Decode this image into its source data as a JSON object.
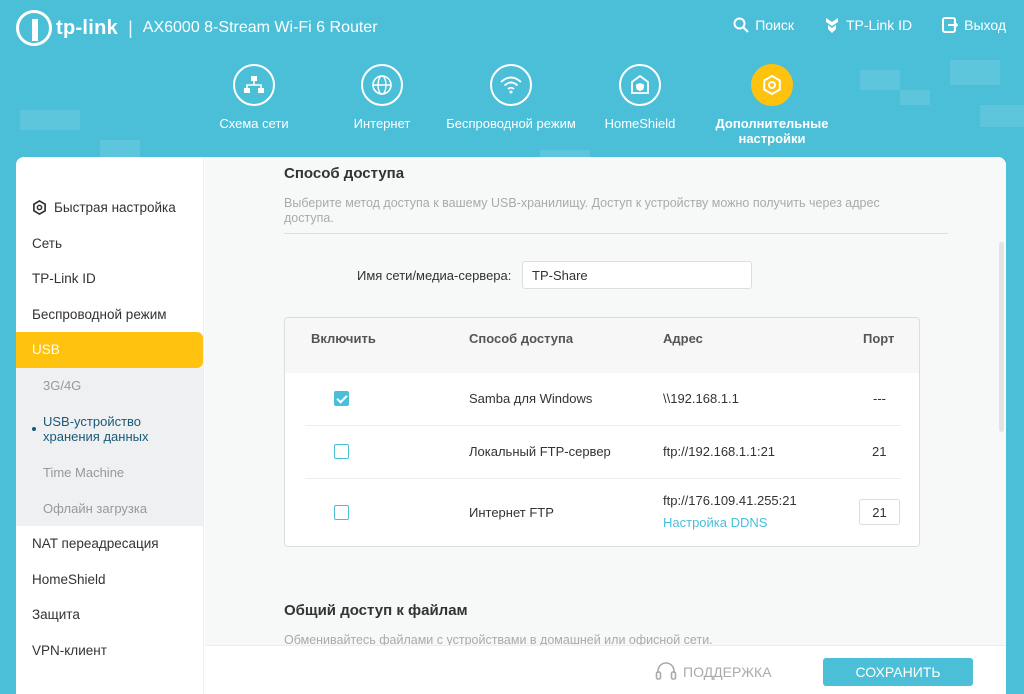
{
  "header": {
    "brand": "tp-link",
    "separator": "|",
    "model": "AX6000 8-Stream Wi-Fi 6 Router",
    "actions": [
      {
        "label": "Поиск",
        "icon": "search-icon"
      },
      {
        "label": "TP-Link ID",
        "icon": "tplink-id-icon"
      },
      {
        "label": "Выход",
        "icon": "logout-icon"
      }
    ]
  },
  "nav": [
    {
      "label": "Схема сети",
      "icon": "network-map-icon"
    },
    {
      "label": "Интернет",
      "icon": "globe-icon"
    },
    {
      "label": "Беспроводной режим",
      "icon": "wifi-icon"
    },
    {
      "label": "HomeShield",
      "icon": "shield-home-icon"
    },
    {
      "label": "Дополнительные настройки",
      "icon": "gear-icon",
      "active": true
    }
  ],
  "sidebar": {
    "items": [
      {
        "label": "Быстрая настройка",
        "icon": "gear-icon"
      },
      {
        "label": "Сеть"
      },
      {
        "label": "TP-Link ID"
      },
      {
        "label": "Беспроводной режим"
      },
      {
        "label": "USB",
        "active": true
      }
    ],
    "usb_sub": [
      {
        "label": "3G/4G"
      },
      {
        "label": "USB-устройство хранения данных",
        "current": true
      },
      {
        "label": "Time Machine"
      },
      {
        "label": "Офлайн загрузка"
      }
    ],
    "items_after": [
      {
        "label": "NAT переадресация"
      },
      {
        "label": "HomeShield"
      },
      {
        "label": "Защита"
      },
      {
        "label": "VPN-клиент"
      }
    ]
  },
  "access": {
    "title": "Способ доступа",
    "description": "Выберите метод доступа к вашему USB-хранилищу. Доступ к устройству можно получить через адрес доступа.",
    "server_name_label": "Имя сети/медиа-сервера:",
    "server_name_value": "TP-Share",
    "table": {
      "headers": {
        "enable": "Включить",
        "method": "Способ доступа",
        "address": "Адрес",
        "port": "Порт"
      },
      "rows": [
        {
          "checked": true,
          "method": "Samba для Windows",
          "address": "\\\\192.168.1.1",
          "port": "---"
        },
        {
          "checked": false,
          "method": "Локальный FTP-сервер",
          "address": "ftp://192.168.1.1:21",
          "port": "21"
        },
        {
          "checked": false,
          "method": "Интернет FTP",
          "address": "ftp://176.109.41.255:21",
          "link": "Настройка DDNS",
          "port": "21"
        }
      ]
    }
  },
  "sharing": {
    "title": "Общий доступ к файлам",
    "description": "Обменивайтесь файлами с устройствами в домашней или офисной сети."
  },
  "footer": {
    "support_label": "ПОДДЕРЖКА",
    "save_label": "СОХРАНИТЬ"
  },
  "colors": {
    "accent": "#4bbfd8",
    "active": "#ffc20e"
  }
}
